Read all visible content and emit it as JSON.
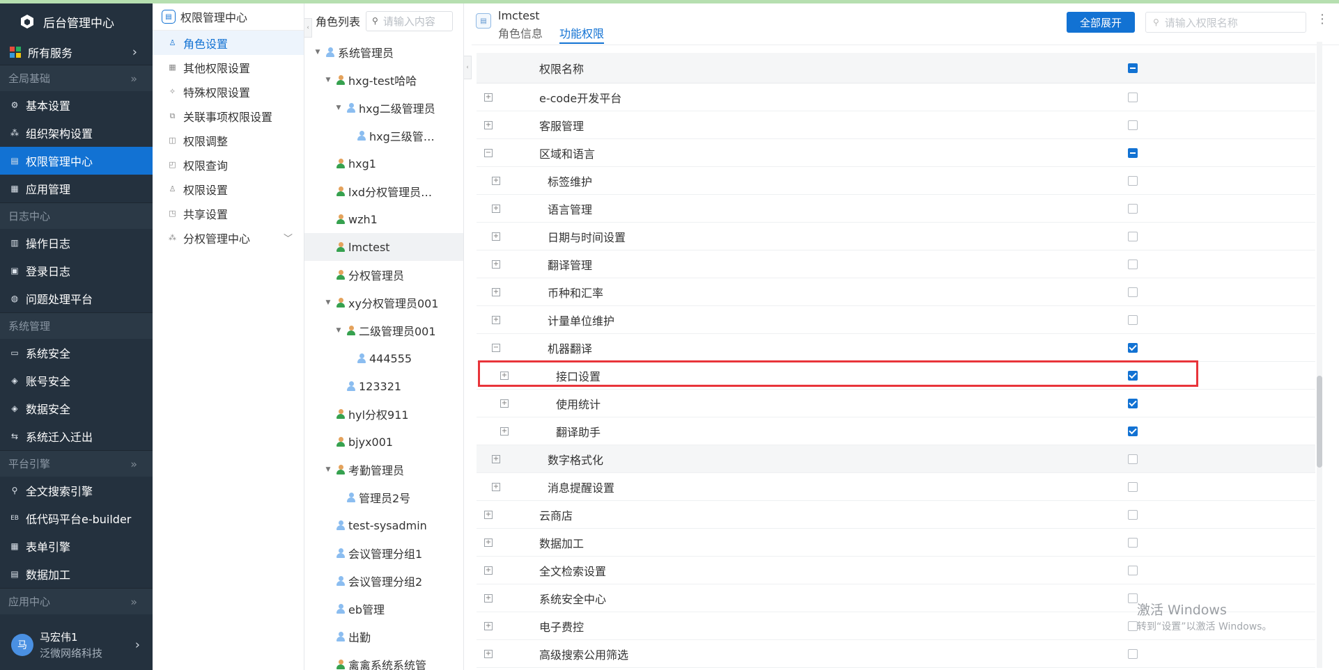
{
  "sidebar": {
    "brand": "后台管理中心",
    "all_services": "所有服务",
    "groups": [
      {
        "title": "全局基础",
        "items": [
          {
            "label": "基本设置",
            "icon": "gear-icon",
            "active": false
          },
          {
            "label": "组织架构设置",
            "icon": "org-icon",
            "active": false
          },
          {
            "label": "权限管理中心",
            "icon": "permission-icon",
            "active": true
          },
          {
            "label": "应用管理",
            "icon": "grid-icon",
            "active": false
          }
        ]
      },
      {
        "title": "日志中心",
        "items": [
          {
            "label": "操作日志",
            "icon": "log-icon",
            "active": false
          },
          {
            "label": "登录日志",
            "icon": "login-log-icon",
            "active": false
          },
          {
            "label": "问题处理平台",
            "icon": "planet-icon",
            "active": false
          }
        ]
      },
      {
        "title": "系统管理",
        "items": [
          {
            "label": "系统安全",
            "icon": "monitor-icon",
            "active": false
          },
          {
            "label": "账号安全",
            "icon": "shield-icon",
            "active": false
          },
          {
            "label": "数据安全",
            "icon": "shield-icon",
            "active": false
          },
          {
            "label": "系统迁入迁出",
            "icon": "migrate-icon",
            "active": false
          }
        ]
      },
      {
        "title": "平台引擎",
        "items": [
          {
            "label": "全文搜索引擎",
            "icon": "search-icon",
            "active": false
          },
          {
            "label": "低代码平台e-builder",
            "icon": "eb-icon",
            "active": false
          },
          {
            "label": "表单引擎",
            "icon": "form-icon",
            "active": false
          },
          {
            "label": "数据加工",
            "icon": "data-icon",
            "active": false
          }
        ]
      },
      {
        "title": "应用中心",
        "items": []
      }
    ],
    "user": {
      "avatar": "马",
      "name": "马宏伟1",
      "org": "泛微网络科技"
    }
  },
  "menu2": {
    "title": "权限管理中心",
    "items": [
      {
        "label": "角色设置",
        "active": true,
        "icon": "role-icon"
      },
      {
        "label": "其他权限设置",
        "active": false,
        "icon": "grid-icon"
      },
      {
        "label": "特殊权限设置",
        "active": false,
        "icon": "special-icon"
      },
      {
        "label": "关联事项权限设置",
        "active": false,
        "icon": "link-icon"
      },
      {
        "label": "权限调整",
        "active": false,
        "icon": "lock-icon"
      },
      {
        "label": "权限查询",
        "active": false,
        "icon": "query-icon"
      },
      {
        "label": "权限设置",
        "active": false,
        "icon": "user-setting-icon"
      },
      {
        "label": "共享设置",
        "active": false,
        "icon": "share-icon"
      },
      {
        "label": "分权管理中心",
        "active": false,
        "icon": "tree-icon",
        "expandable": true
      }
    ]
  },
  "roles": {
    "title": "角色列表",
    "search_placeholder": "请输入内容",
    "items": [
      {
        "label": "系统管理员",
        "depth": 0,
        "toggle": "open",
        "color": "blue"
      },
      {
        "label": "hxg-test哈哈",
        "depth": 1,
        "toggle": "open",
        "color": "green"
      },
      {
        "label": "hxg二级管理员",
        "depth": 2,
        "toggle": "open",
        "color": "blue"
      },
      {
        "label": "hxg三级管…",
        "depth": 3,
        "toggle": "none",
        "color": "blue"
      },
      {
        "label": "hxg1",
        "depth": 1,
        "toggle": "none",
        "color": "green"
      },
      {
        "label": "lxd分权管理员…",
        "depth": 1,
        "toggle": "none",
        "color": "green"
      },
      {
        "label": "wzh1",
        "depth": 1,
        "toggle": "none",
        "color": "green"
      },
      {
        "label": "lmctest",
        "depth": 1,
        "toggle": "none",
        "color": "green",
        "active": true
      },
      {
        "label": "分权管理员",
        "depth": 1,
        "toggle": "none",
        "color": "green"
      },
      {
        "label": "xy分权管理员001",
        "depth": 1,
        "toggle": "open",
        "color": "green"
      },
      {
        "label": "二级管理员001",
        "depth": 2,
        "toggle": "open",
        "color": "green"
      },
      {
        "label": "444555",
        "depth": 3,
        "toggle": "none",
        "color": "blue"
      },
      {
        "label": "123321",
        "depth": 2,
        "toggle": "none",
        "color": "blue"
      },
      {
        "label": "hyl分权911",
        "depth": 1,
        "toggle": "none",
        "color": "green"
      },
      {
        "label": "bjyx001",
        "depth": 1,
        "toggle": "none",
        "color": "green"
      },
      {
        "label": "考勤管理员",
        "depth": 1,
        "toggle": "open",
        "color": "green"
      },
      {
        "label": "管理员2号",
        "depth": 2,
        "toggle": "none",
        "color": "blue"
      },
      {
        "label": "test-sysadmin",
        "depth": 1,
        "toggle": "none",
        "color": "blue"
      },
      {
        "label": "会议管理分组1",
        "depth": 1,
        "toggle": "none",
        "color": "blue"
      },
      {
        "label": "会议管理分组2",
        "depth": 1,
        "toggle": "none",
        "color": "blue"
      },
      {
        "label": "eb管理",
        "depth": 1,
        "toggle": "none",
        "color": "blue"
      },
      {
        "label": "出勤",
        "depth": 1,
        "toggle": "none",
        "color": "blue"
      },
      {
        "label": "禽禽系统系统管",
        "depth": 1,
        "toggle": "none",
        "color": "green"
      }
    ]
  },
  "main": {
    "title": "lmctest",
    "tabs": [
      {
        "label": "角色信息",
        "active": false
      },
      {
        "label": "功能权限",
        "active": true
      }
    ],
    "expand_all": "全部展开",
    "search_placeholder": "请输入权限名称",
    "column_name": "权限名称",
    "header_check": "partial",
    "rows": [
      {
        "label": "e-code开发平台",
        "depth": 0,
        "toggle": "plus",
        "check": "none"
      },
      {
        "label": "客服管理",
        "depth": 0,
        "toggle": "plus",
        "check": "none"
      },
      {
        "label": "区域和语言",
        "depth": 0,
        "toggle": "minus",
        "check": "partial"
      },
      {
        "label": "标签维护",
        "depth": 1,
        "toggle": "plus",
        "check": "none"
      },
      {
        "label": "语言管理",
        "depth": 1,
        "toggle": "plus",
        "check": "none"
      },
      {
        "label": "日期与时间设置",
        "depth": 1,
        "toggle": "plus",
        "check": "none"
      },
      {
        "label": "翻译管理",
        "depth": 1,
        "toggle": "plus",
        "check": "none"
      },
      {
        "label": "币种和汇率",
        "depth": 1,
        "toggle": "plus",
        "check": "none"
      },
      {
        "label": "计量单位维护",
        "depth": 1,
        "toggle": "plus",
        "check": "none"
      },
      {
        "label": "机器翻译",
        "depth": 1,
        "toggle": "minus",
        "check": "checked"
      },
      {
        "label": "接口设置",
        "depth": 2,
        "toggle": "plus",
        "check": "checked"
      },
      {
        "label": "使用统计",
        "depth": 2,
        "toggle": "plus",
        "check": "checked"
      },
      {
        "label": "翻译助手",
        "depth": 2,
        "toggle": "plus",
        "check": "checked"
      },
      {
        "label": "数字格式化",
        "depth": 1,
        "toggle": "plus",
        "check": "none",
        "hover": true
      },
      {
        "label": "消息提醒设置",
        "depth": 1,
        "toggle": "plus",
        "check": "none"
      },
      {
        "label": "云商店",
        "depth": 0,
        "toggle": "plus",
        "check": "none"
      },
      {
        "label": "数据加工",
        "depth": 0,
        "toggle": "plus",
        "check": "none"
      },
      {
        "label": "全文检索设置",
        "depth": 0,
        "toggle": "plus",
        "check": "none"
      },
      {
        "label": "系统安全中心",
        "depth": 0,
        "toggle": "plus",
        "check": "none"
      },
      {
        "label": "电子费控",
        "depth": 0,
        "toggle": "plus",
        "check": "none"
      },
      {
        "label": "高级搜索公用筛选",
        "depth": 0,
        "toggle": "plus",
        "check": "none"
      }
    ]
  },
  "watermark": {
    "line1": "激活 Windows",
    "line2": "转到“设置”以激活 Windows。"
  },
  "colors": {
    "accent": "#1272d3",
    "sidebar_bg": "#24313e",
    "highlight": "#e8343a"
  }
}
